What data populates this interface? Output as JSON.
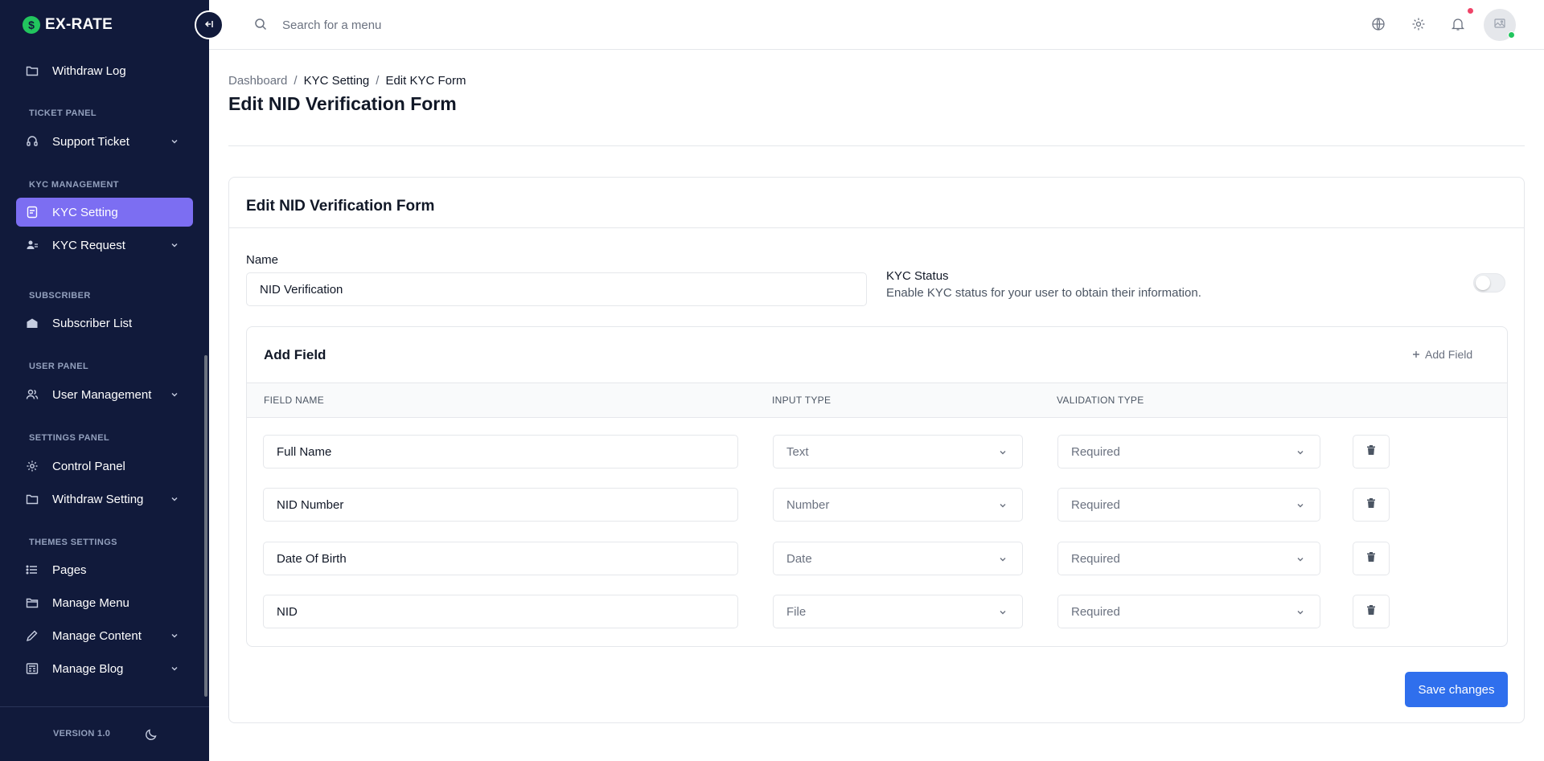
{
  "brand": {
    "name": "EX-RATE",
    "logo_glyph": "$"
  },
  "sidebar": {
    "sections": [
      {
        "label": "TICKET PANEL"
      },
      {
        "label": "KYC MANAGEMENT"
      },
      {
        "label": "SUBSCRIBER"
      },
      {
        "label": "USER PANEL"
      },
      {
        "label": "SETTINGS PANEL"
      },
      {
        "label": "THEMES SETTINGS"
      }
    ],
    "items": [
      {
        "label": "Withdraw Log",
        "icon": "folder-icon",
        "has_chevron": false,
        "active": false
      },
      {
        "label": "Support Ticket",
        "icon": "headset-icon",
        "has_chevron": true,
        "active": false
      },
      {
        "label": "KYC Setting",
        "icon": "document-icon",
        "has_chevron": false,
        "active": true
      },
      {
        "label": "KYC Request",
        "icon": "user-group-icon",
        "has_chevron": true,
        "active": false
      },
      {
        "label": "Subscriber List",
        "icon": "envelope-icon",
        "has_chevron": false,
        "active": false
      },
      {
        "label": "User Management",
        "icon": "users-icon",
        "has_chevron": true,
        "active": false
      },
      {
        "label": "Control Panel",
        "icon": "gear-icon",
        "has_chevron": false,
        "active": false
      },
      {
        "label": "Withdraw Setting",
        "icon": "folder-icon",
        "has_chevron": true,
        "active": false
      },
      {
        "label": "Pages",
        "icon": "list-icon",
        "has_chevron": false,
        "active": false
      },
      {
        "label": "Manage Menu",
        "icon": "folder-open-icon",
        "has_chevron": false,
        "active": false
      },
      {
        "label": "Manage Content",
        "icon": "pencil-icon",
        "has_chevron": true,
        "active": false
      },
      {
        "label": "Manage Blog",
        "icon": "newspaper-icon",
        "has_chevron": true,
        "active": false
      }
    ],
    "version": "VERSION 1.0"
  },
  "topbar": {
    "search_placeholder": "Search for a menu"
  },
  "breadcrumb": {
    "items": [
      "Dashboard",
      "KYC Setting",
      "Edit KYC Form"
    ],
    "separator": "/"
  },
  "page_title": "Edit NID Verification Form",
  "form": {
    "card_title": "Edit NID Verification Form",
    "name_label": "Name",
    "name_value": "NID Verification",
    "kyc_status_title": "KYC Status",
    "kyc_status_desc": "Enable KYC status for your user to obtain their information.",
    "kyc_status_enabled": false,
    "add_field_title": "Add Field",
    "add_field_button": "Add Field",
    "columns": [
      "FIELD NAME",
      "INPUT TYPE",
      "VALIDATION TYPE"
    ],
    "fields": [
      {
        "name": "Full Name",
        "input_type": "Text",
        "validation": "Required"
      },
      {
        "name": "NID Number",
        "input_type": "Number",
        "validation": "Required"
      },
      {
        "name": "Date Of Birth",
        "input_type": "Date",
        "validation": "Required"
      },
      {
        "name": "NID",
        "input_type": "File",
        "validation": "Required"
      }
    ],
    "save_button": "Save changes"
  },
  "colors": {
    "sidebar_bg": "#111a3b",
    "active_item": "#7c6ef2",
    "primary_button": "#2f6fed",
    "notification_dot": "#ef4468",
    "online_dot": "#22c55e"
  }
}
